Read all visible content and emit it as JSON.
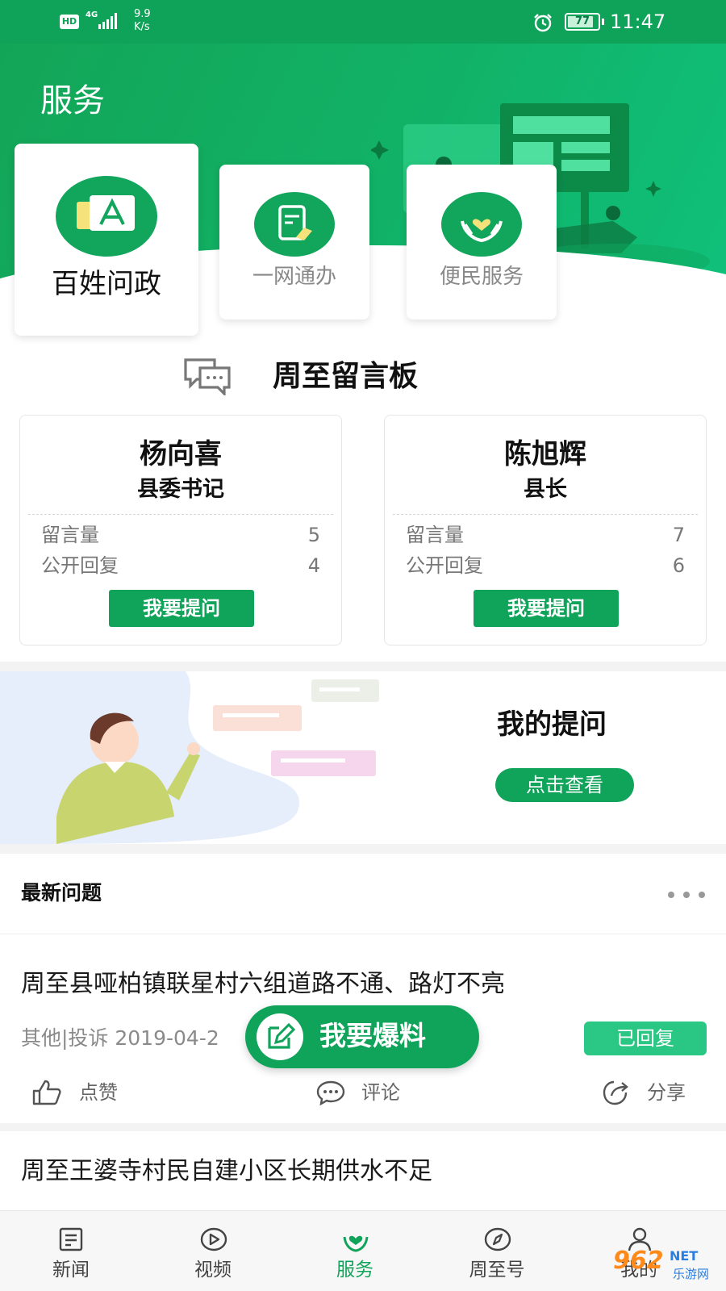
{
  "status_bar": {
    "hd": "HD",
    "network": "4G",
    "speed_value": "9.9",
    "speed_unit": "K/s",
    "battery": "77",
    "time": "11:47",
    "icons": [
      "signal-icon",
      "alarm-icon",
      "battery-icon"
    ]
  },
  "header": {
    "title": "服务"
  },
  "services": [
    {
      "label": "百姓问政",
      "icon": "chat-a-icon"
    },
    {
      "label": "一网通办",
      "icon": "document-edit-icon"
    },
    {
      "label": "便民服务",
      "icon": "heart-hands-icon"
    }
  ],
  "board": {
    "title": "周至留言板",
    "icon": "speech-bubbles-icon",
    "leaders": [
      {
        "name": "杨向喜",
        "role": "县委书记",
        "messages_label": "留言量",
        "messages": "5",
        "replies_label": "公开回复",
        "replies": "4",
        "ask_label": "我要提问"
      },
      {
        "name": "陈旭辉",
        "role": "县长",
        "messages_label": "留言量",
        "messages": "7",
        "replies_label": "公开回复",
        "replies": "6",
        "ask_label": "我要提问"
      }
    ]
  },
  "my_questions": {
    "title": "我的提问",
    "button": "点击查看"
  },
  "latest": {
    "title": "最新问题",
    "more_icon": "more-dots-icon",
    "items": [
      {
        "title": "周至县哑柏镇联星村六组道路不通、路灯不亮",
        "meta": "其他|投诉   2019-04-2",
        "status": "已回复",
        "like": "点赞",
        "comment": "评论",
        "share": "分享"
      },
      {
        "title": "周至王婆寺村民自建小区长期供水不足"
      }
    ]
  },
  "fab": {
    "label": "我要爆料",
    "icon": "edit-pen-icon"
  },
  "nav": [
    {
      "label": "新闻",
      "icon": "news-icon",
      "active": false
    },
    {
      "label": "视频",
      "icon": "play-icon",
      "active": false
    },
    {
      "label": "服务",
      "icon": "heart-hands-icon",
      "active": true
    },
    {
      "label": "周至号",
      "icon": "compass-icon",
      "active": false
    },
    {
      "label": "我的",
      "icon": "user-icon",
      "active": false
    }
  ],
  "watermark": {
    "brand": "962",
    "suffix": "NET",
    "sub": "乐游网"
  },
  "colors": {
    "primary": "#10a35a",
    "status_bar": "#0fa35a",
    "replied_badge": "#19c27a"
  }
}
